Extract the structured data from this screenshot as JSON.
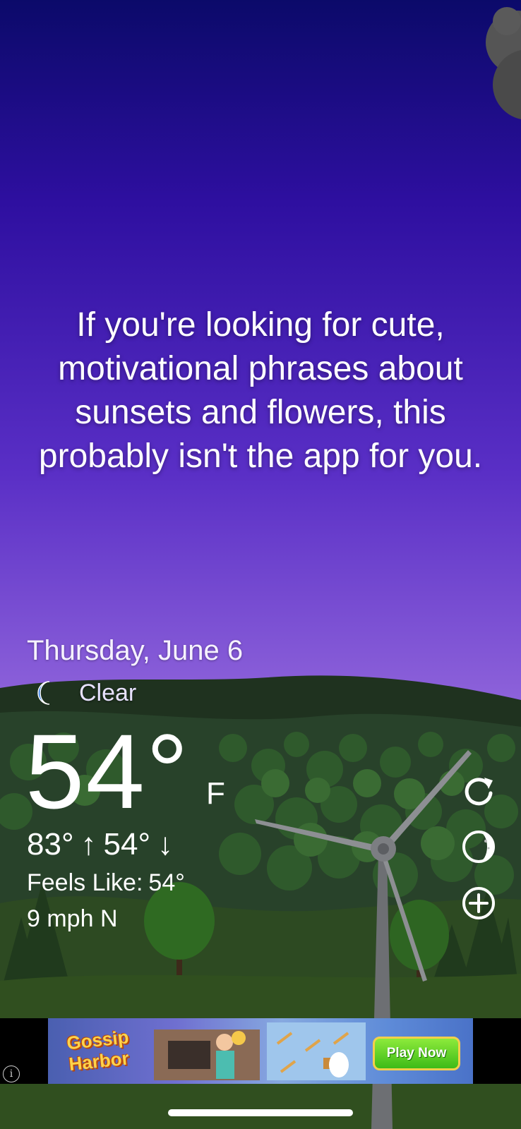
{
  "quote": {
    "text": "If you're looking for cute, motivational phrases about sunsets and flowers, this probably isn't the app for you."
  },
  "weather": {
    "date": "Thursday, June 6",
    "condition": "Clear",
    "condition_icon": "crescent-moon-icon",
    "temperature": "54°",
    "unit": "F",
    "high": "83°",
    "high_arrow": "↑",
    "low": "54°",
    "low_arrow": "↓",
    "feels_like_label": "Feels Like:",
    "feels_like_value": "54°",
    "wind": "9 mph N"
  },
  "side_buttons": [
    {
      "icon": "refresh-icon"
    },
    {
      "icon": "moon-phase-icon"
    },
    {
      "icon": "add-location-icon"
    }
  ],
  "ad": {
    "title": "Gossip Harbor",
    "cta": "Play Now",
    "info_icon": "info-icon"
  },
  "colors": {
    "sky_top": "#0b0a6a",
    "sky_mid": "#5a2fc6",
    "sky_bottom": "#c3a9f3",
    "hills": "#243a20",
    "text": "#ffffff",
    "moon": "#1e6fe0"
  }
}
